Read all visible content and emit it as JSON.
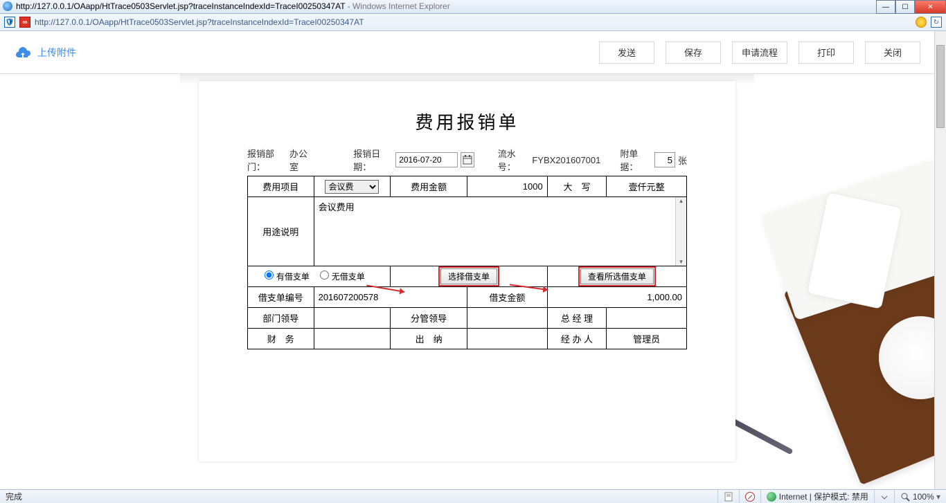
{
  "window": {
    "title_url": "http://127.0.0.1/OAapp/HtTrace0503Servlet.jsp?traceInstanceIndexId=TraceI00250347AT",
    "title_browser": " - Windows Internet Explorer"
  },
  "addressbar": {
    "url": "http://127.0.0.1/OAapp/HtTrace0503Servlet.jsp?traceInstanceIndexId=TraceI00250347AT"
  },
  "toolbar": {
    "upload_label": "上传附件",
    "send": "发送",
    "save": "保存",
    "apply_flow": "申请流程",
    "print": "打印",
    "close": "关闭"
  },
  "form": {
    "title": "费用报销单",
    "dept_label": "报销部门：",
    "dept_value": "办公室",
    "date_label": "报销日期：",
    "date_value": "2016-07-20",
    "serial_label": "流水号：",
    "serial_value": "FYBX201607001",
    "attach_label": "附单据：",
    "attach_count": "5",
    "attach_unit": "张",
    "expense_item_label": "费用项目",
    "expense_item_value": "会议费",
    "expense_amount_label": "费用金额",
    "expense_amount_value": "1000",
    "upper_label": "大　写",
    "upper_value": "壹仟元整",
    "purpose_label": "用途说明",
    "purpose_text": "会议费用",
    "radio_has_loan": "有借支单",
    "radio_no_loan": "无借支单",
    "select_loan_btn": "选择借支单",
    "view_loan_btn": "查看所选借支单",
    "loan_no_label": "借支单编号",
    "loan_no_value": "201607200578",
    "loan_amt_label": "借支金额",
    "loan_amt_value": "1,000.00",
    "dept_leader": "部门领导",
    "branch_leader": "分管领导",
    "gm": "总 经 理",
    "finance": "财　务",
    "cashier": "出　纳",
    "handler": "经 办 人",
    "admin": "管理员"
  },
  "statusbar": {
    "done": "完成",
    "internet": "Internet | 保护模式: 禁用",
    "zoom": "100%"
  }
}
